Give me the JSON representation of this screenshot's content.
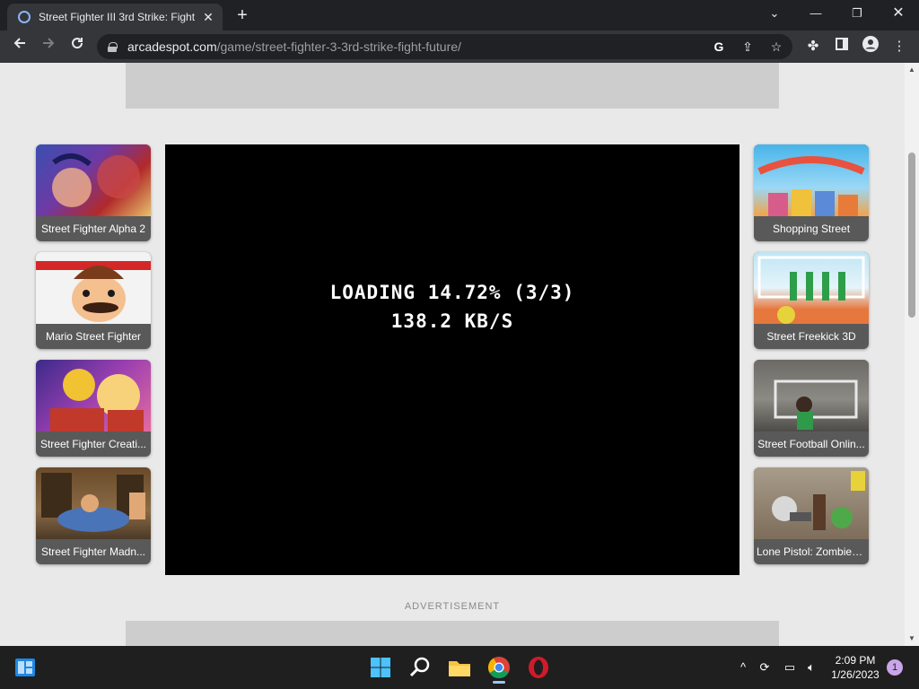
{
  "browser": {
    "tab_title": "Street Fighter III 3rd Strike: Fight",
    "url_host": "arcadespot.com",
    "url_path": "/game/street-fighter-3-3rd-strike-fight-future/"
  },
  "game": {
    "loading_line1": "LOADING 14.72% (3/3)",
    "loading_line2": "138.2 KB/S",
    "loading_percent": 14.72
  },
  "left_games": [
    {
      "label": "Street Fighter Alpha 2"
    },
    {
      "label": "Mario Street Fighter"
    },
    {
      "label": "Street Fighter Creati..."
    },
    {
      "label": "Street Fighter Madn..."
    }
  ],
  "right_games": [
    {
      "label": "Shopping Street"
    },
    {
      "label": "Street Freekick 3D"
    },
    {
      "label": "Street Football Onlin..."
    },
    {
      "label": "Lone Pistol: Zombies..."
    }
  ],
  "ad_label": "ADVERTISEMENT",
  "taskbar": {
    "time": "2:09 PM",
    "date": "1/26/2023",
    "notification_count": "1"
  },
  "colors": {
    "chrome_dark": "#202124",
    "chrome_toolbar": "#35363a",
    "page_bg": "#e9e9e9",
    "card_label_bg": "#595959"
  }
}
